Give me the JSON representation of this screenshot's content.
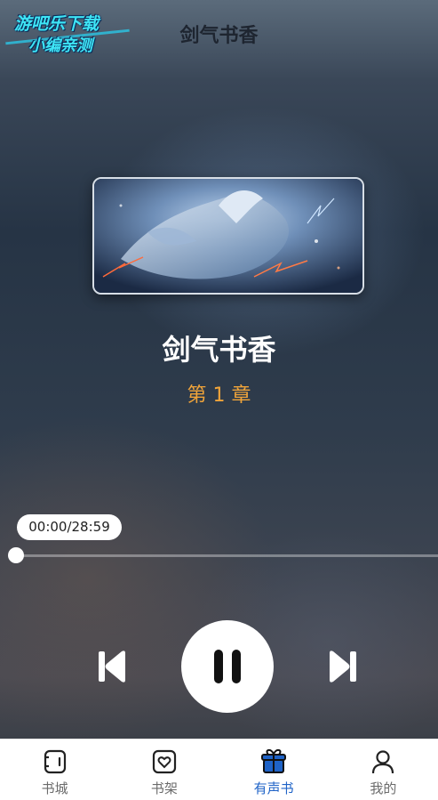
{
  "brand": {
    "line1": "游吧乐下载",
    "line2": "小编亲测"
  },
  "header": {
    "title": "剑气书香"
  },
  "book": {
    "title": "剑气书香",
    "chapter": "第 1 章"
  },
  "player": {
    "time_display": "00:00/28:59",
    "progress_fraction": 0,
    "state": "playing"
  },
  "controls": {
    "prev_icon": "skip-previous-icon",
    "toggle_icon": "pause-icon",
    "next_icon": "skip-next-icon"
  },
  "tabs": [
    {
      "label": "书城",
      "icon": "bookstore-icon",
      "active": false
    },
    {
      "label": "书架",
      "icon": "bookshelf-heart-icon",
      "active": false
    },
    {
      "label": "有声书",
      "icon": "audiobook-gift-icon",
      "active": true
    },
    {
      "label": "我的",
      "icon": "user-profile-icon",
      "active": false
    }
  ],
  "colors": {
    "accent": "#1f63c7",
    "chapter": "#f0a43a",
    "brand": "#3ee4f5"
  }
}
